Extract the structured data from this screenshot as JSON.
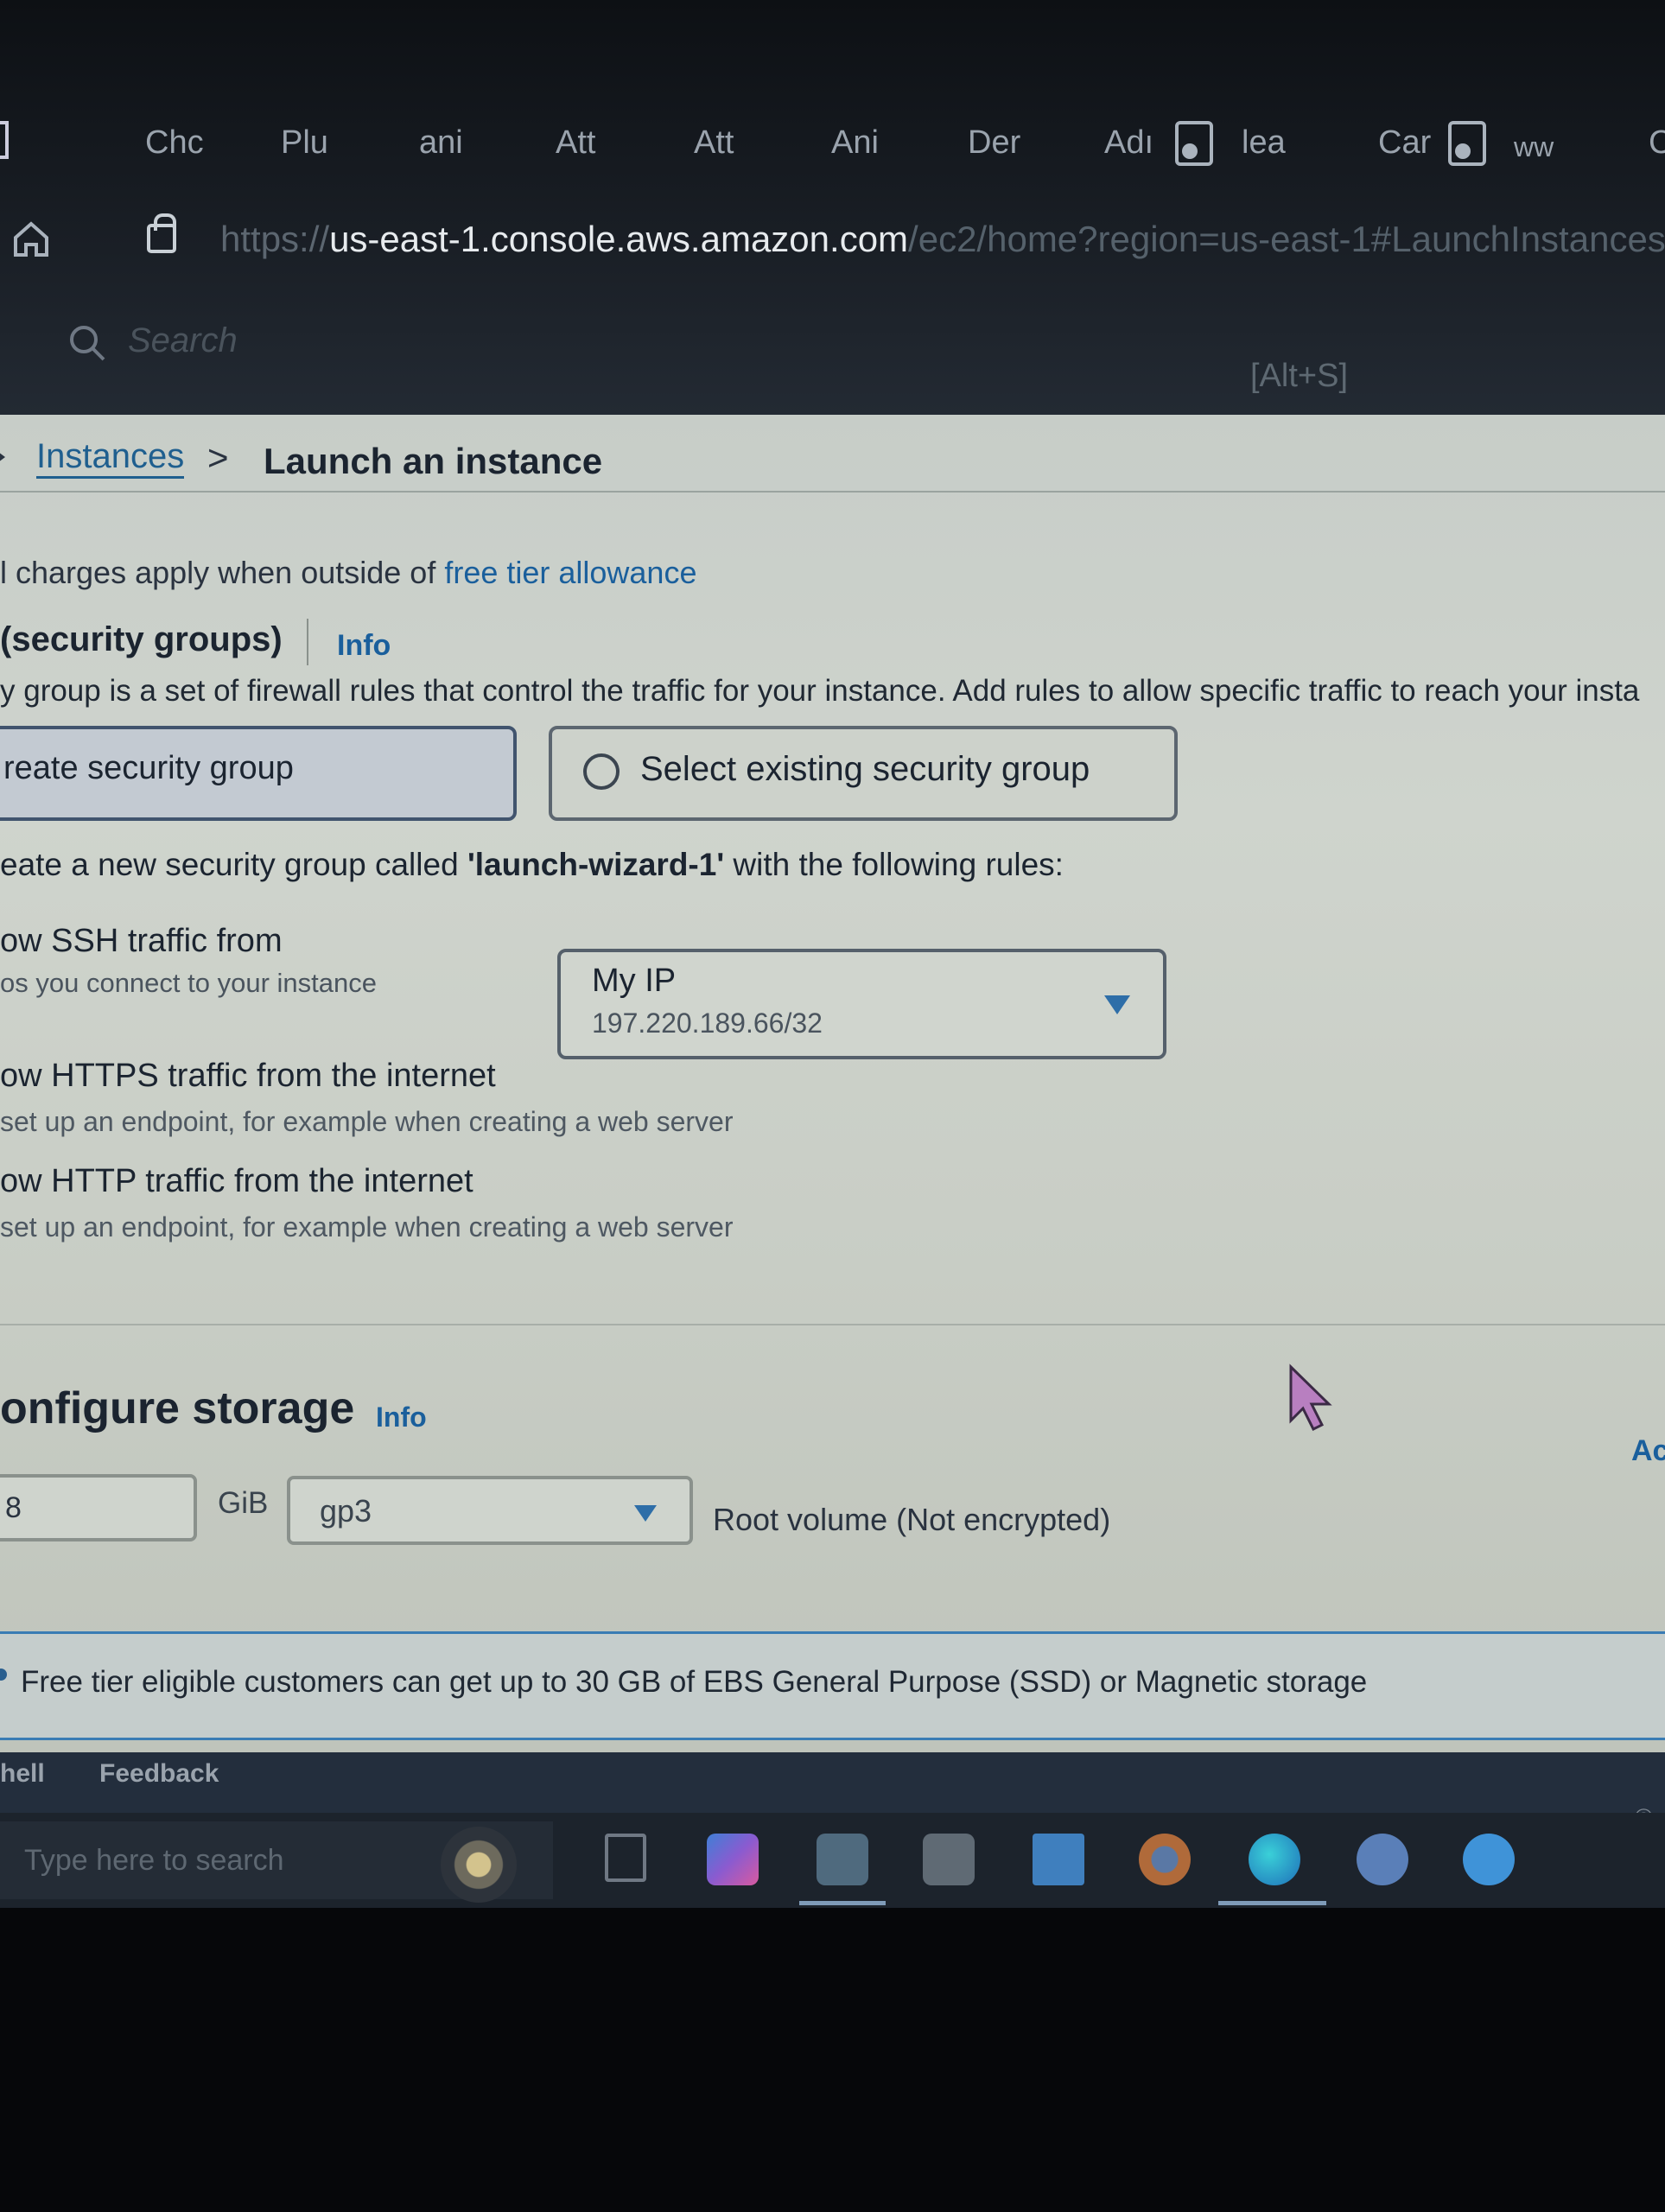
{
  "browser": {
    "tabs": [
      {
        "label": "Chc"
      },
      {
        "label": "Plu"
      },
      {
        "label": "ani"
      },
      {
        "label": "Att"
      },
      {
        "label": "Att"
      },
      {
        "label": "Ani"
      },
      {
        "label": "Der"
      },
      {
        "label": "Adı"
      },
      {
        "label": "lea"
      },
      {
        "label": "Car"
      },
      {
        "label": "ww"
      },
      {
        "label": "C"
      }
    ],
    "url": {
      "scheme": "https://",
      "host": "us-east-1.console.aws.amazon.com",
      "path": "/ec2/home?region=us-east-1#LaunchInstances:"
    },
    "search_placeholder": "Search",
    "search_shortcut": "[Alt+S]"
  },
  "breadcrumb": {
    "parent": "Instances",
    "separator": ">",
    "current": "Launch an instance"
  },
  "charges_note": {
    "text": "l charges apply when outside of ",
    "link": "free tier allowance"
  },
  "security_groups": {
    "title": "(security groups)",
    "info_link": "Info",
    "description": "y group is a set of firewall rules that control the traffic for your instance. Add rules to allow specific traffic to reach your insta",
    "option_create": "reate security group",
    "option_select": "Select existing security group",
    "new_group_prefix": "eate a new security group called ",
    "new_group_name": "'launch-wizard-1'",
    "new_group_suffix": " with the following rules:",
    "ssh_label": "ow SSH traffic from",
    "ssh_sub": "os you connect to your instance",
    "ssh_source_label": "My IP",
    "ssh_source_value": "197.220.189.66/32",
    "https_label": "ow HTTPS traffic from the internet",
    "https_sub": "set up an endpoint, for example when creating a web server",
    "http_label": "ow HTTP traffic from the internet",
    "http_sub": "set up an endpoint, for example when creating a web server"
  },
  "storage": {
    "title": "onfigure storage",
    "info_link": "Info",
    "right_edge_link": "Ac",
    "size": "8",
    "unit": "GiB",
    "volume_type": "gp3",
    "root_volume": "Root volume  (Not encrypted)",
    "free_tier_note": "Free tier eligible customers can get up to 30 GB of EBS General Purpose (SSD) or Magnetic storage"
  },
  "footer": {
    "shell": "hell",
    "feedback": "Feedback",
    "copyright": "©"
  },
  "taskbar": {
    "search_placeholder": "Type here to search"
  },
  "colors": {
    "link": "#1a5f9c",
    "page_bg": "#cbd0c9",
    "chrome_bg": "#1a1f26",
    "footer_bg": "#232e3d",
    "caret": "#2e6ea8"
  }
}
